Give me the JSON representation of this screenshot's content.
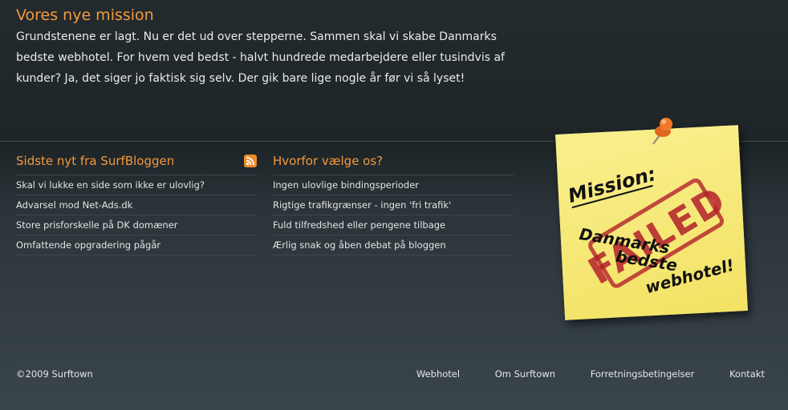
{
  "mission": {
    "title": "Vores nye mission",
    "text": "Grundstenene er lagt. Nu er det ud over stepperne. Sammen skal vi skabe Danmarks bedste webhotel. For hvem ved bedst - halvt hundrede medarbejdere eller tusindvis af kunder? Ja, det siger jo faktisk sig selv. Der gik bare lige nogle år før vi så lyset!"
  },
  "blog": {
    "title": "Sidste nyt fra SurfBloggen",
    "items": [
      "Skal vi lukke en side som ikke er ulovlig?",
      "Advarsel mod Net-Ads.dk",
      "Store prisforskelle på DK domæner",
      "Omfattende opgradering pågår"
    ]
  },
  "why": {
    "title": "Hvorfor vælge os?",
    "items": [
      "Ingen ulovlige bindingsperioder",
      "Rigtige trafikgrænser - ingen 'fri trafik'",
      "Fuld tilfredshed eller pengene tilbage",
      "Ærlig snak og åben debat på bloggen"
    ]
  },
  "note": {
    "heading": "Mission:",
    "line1": "Danmarks",
    "line2": "bedste",
    "line3": "webhotel!",
    "stamp": "FAILED"
  },
  "footer": {
    "copyright": "©2009 Surftown",
    "links": [
      "Webhotel",
      "Om Surftown",
      "Forretningsbetingelser",
      "Kontakt"
    ]
  },
  "colors": {
    "accent": "#f39a3a",
    "note": "#f7e97c",
    "stamp": "#b3202a"
  }
}
